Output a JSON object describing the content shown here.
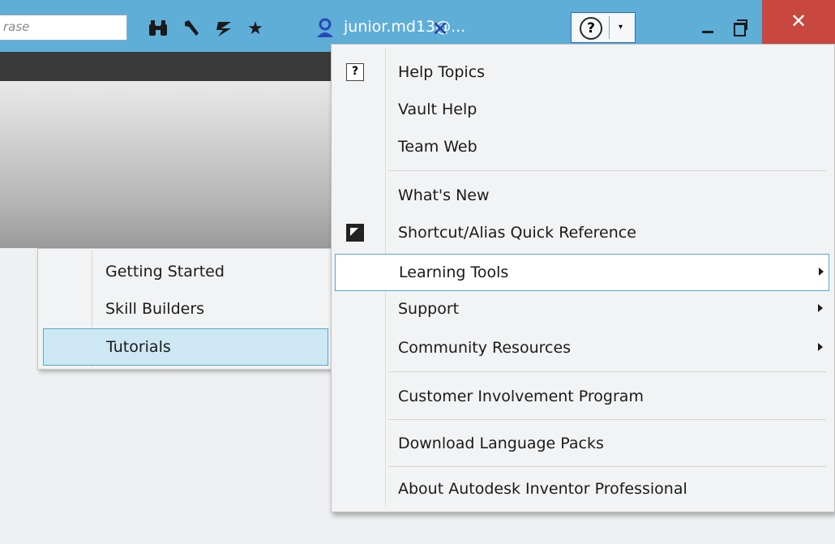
{
  "titlebar": {
    "search_placeholder": "rase",
    "user_label": "junior.md13@...",
    "help_symbol": "?",
    "close_symbol": "✕",
    "binoculars_glyph": "🔭",
    "wrench_glyph": "🔧",
    "satellite_glyph": "📡",
    "star_glyph": "★",
    "user_glyph": "👤",
    "x_glyph": "✕"
  },
  "submenu": {
    "items": [
      {
        "label": "Getting Started"
      },
      {
        "label": "Skill Builders"
      },
      {
        "label": "Tutorials",
        "active": true
      }
    ]
  },
  "help_menu": {
    "items": [
      {
        "label": "Help Topics",
        "icon": "help-topics-icon"
      },
      {
        "label": "Vault Help"
      },
      {
        "label": "Team Web"
      },
      {
        "label": "What's New"
      },
      {
        "label": "Shortcut/Alias Quick Reference",
        "icon": "shortcut-icon"
      },
      {
        "label": "Learning Tools",
        "submenu": true,
        "active": true
      },
      {
        "label": "Support",
        "submenu": true
      },
      {
        "label": "Community Resources",
        "submenu": true
      },
      {
        "label": "Customer Involvement Program"
      },
      {
        "label": "Download Language Packs"
      },
      {
        "label": "About Autodesk Inventor Professional"
      }
    ]
  },
  "colors": {
    "titlebar_bg": "#5eaed8",
    "close_bg": "#c8473f",
    "highlight_border": "#58a8c8",
    "submenu_active_bg": "#cde8f4"
  }
}
